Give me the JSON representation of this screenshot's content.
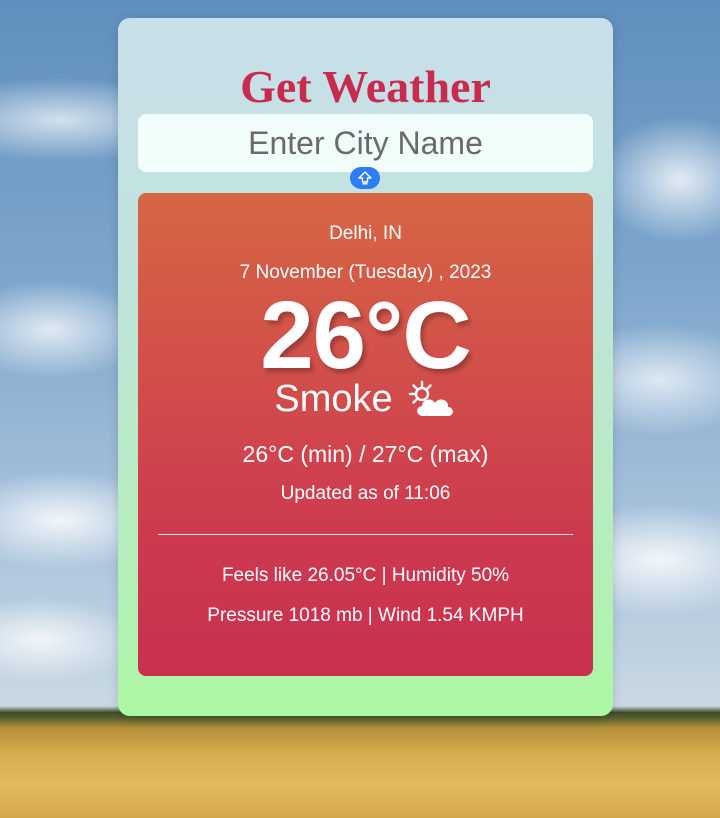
{
  "app": {
    "title": "Get Weather"
  },
  "search": {
    "placeholder": "Enter City Name",
    "value": "",
    "button_icon": "up-arrow-icon"
  },
  "weather": {
    "location": "Delhi, IN",
    "date": "7 November (Tuesday) , 2023",
    "temperature": "26°C",
    "condition": "Smoke",
    "condition_icon": "sun-behind-cloud-icon",
    "min_max": "26°C (min) / 27°C (max)",
    "updated": "Updated as of 11:06",
    "details_line1": "Feels like 26.05°C | Humidity 50%",
    "details_line2": "Pressure 1018 mb | Wind 1.54 KMPH"
  },
  "colors": {
    "title": "#c72c4f",
    "accent_button": "#2f7df4",
    "result_top": "#d66644",
    "result_bottom": "#c9304f"
  }
}
